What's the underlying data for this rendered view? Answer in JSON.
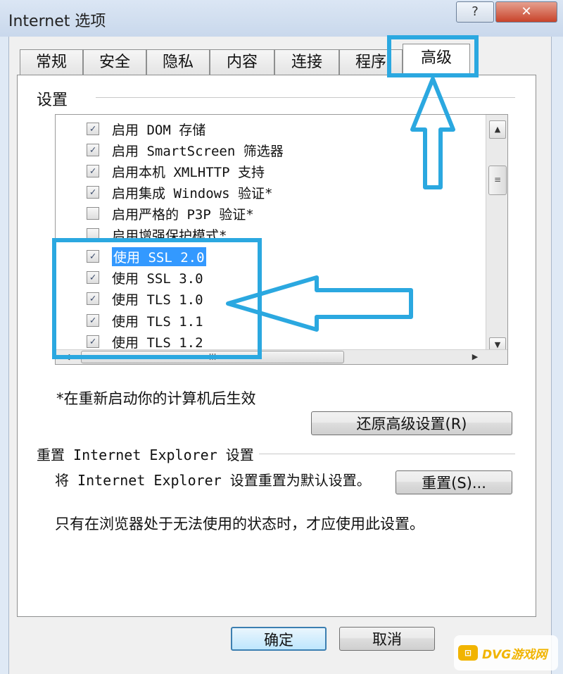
{
  "window": {
    "title": "Internet 选项",
    "help_label": "?",
    "close_label": "✕"
  },
  "tabs": [
    {
      "label": "常规"
    },
    {
      "label": "安全"
    },
    {
      "label": "隐私"
    },
    {
      "label": "内容"
    },
    {
      "label": "连接"
    },
    {
      "label": "程序"
    },
    {
      "label": "高级",
      "active": true
    }
  ],
  "settings": {
    "group_label": "设置",
    "items": [
      {
        "label": "启用 DOM 存储",
        "checked": true
      },
      {
        "label": "启用 SmartScreen 筛选器",
        "checked": true
      },
      {
        "label": "启用本机 XMLHTTP 支持",
        "checked": true
      },
      {
        "label": "启用集成 Windows 验证*",
        "checked": true
      },
      {
        "label": "启用严格的 P3P 验证*",
        "checked": false
      },
      {
        "label": "启用增强保护模式*",
        "checked": false
      },
      {
        "label": "使用 SSL 2.0",
        "checked": true,
        "selected": true
      },
      {
        "label": "使用 SSL 3.0",
        "checked": true
      },
      {
        "label": "使用 TLS 1.0",
        "checked": true
      },
      {
        "label": "使用 TLS 1.1",
        "checked": true
      },
      {
        "label": "使用 TLS 1.2",
        "checked": true
      }
    ],
    "check_mark": "✓",
    "scroll_up": "▲",
    "scroll_down": "▼",
    "scroll_left": "◀",
    "scroll_right": "▶",
    "grip": "≡",
    "hgrip": "III"
  },
  "restart_note": "*在重新启动你的计算机后生效",
  "restore_button": "还原高级设置(R)",
  "reset_section": {
    "group_label": "重置 Internet Explorer 设置",
    "description": "将 Internet Explorer 设置重置为默认设置。",
    "reset_button": "重置(S)...",
    "warning": "只有在浏览器处于无法使用的状态时，才应使用此设置。"
  },
  "footer": {
    "ok_label": "确定",
    "cancel_label": "取消"
  },
  "watermark": {
    "icon": "⊡",
    "text": "DVG游戏网"
  },
  "colors": {
    "highlight": "#2ba8e0",
    "selection": "#3399ff"
  }
}
